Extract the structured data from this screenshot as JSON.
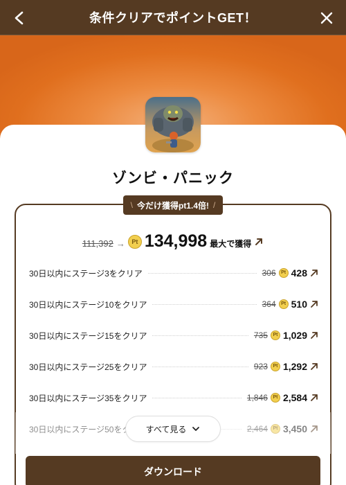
{
  "header": {
    "title": "条件クリアでポイントGET！",
    "back_icon": "chevron-left-icon",
    "close_icon": "close-icon"
  },
  "app": {
    "name": "ゾンビ・パニック",
    "icon": "app-icon"
  },
  "promo": {
    "ribbon_text": "今だけ獲得pt1.4倍!",
    "ribbon_left": "\\",
    "ribbon_right": "/"
  },
  "total": {
    "old_value": "111,392",
    "arrow": "→",
    "coin_label": "Pt",
    "new_value": "134,998",
    "suffix": "最大で獲得"
  },
  "tasks": [
    {
      "label": "30日以内にステージ3をクリア",
      "old": "306",
      "new": "428"
    },
    {
      "label": "30日以内にステージ10をクリア",
      "old": "364",
      "new": "510"
    },
    {
      "label": "30日以内にステージ15をクリア",
      "old": "735",
      "new": "1,029"
    },
    {
      "label": "30日以内にステージ25をクリア",
      "old": "923",
      "new": "1,292"
    },
    {
      "label": "30日以内にステージ35をクリア",
      "old": "1,846",
      "new": "2,584"
    },
    {
      "label": "30日以内にステージ50をクリア",
      "old": "2,464",
      "new": "3,450"
    }
  ],
  "see_all": {
    "label": "すべて見る"
  },
  "download": {
    "label": "ダウンロード"
  },
  "colors": {
    "brand_brown": "#553a22",
    "banner_orange": "#e06f1e",
    "coin_gold": "#f2cf4e"
  }
}
